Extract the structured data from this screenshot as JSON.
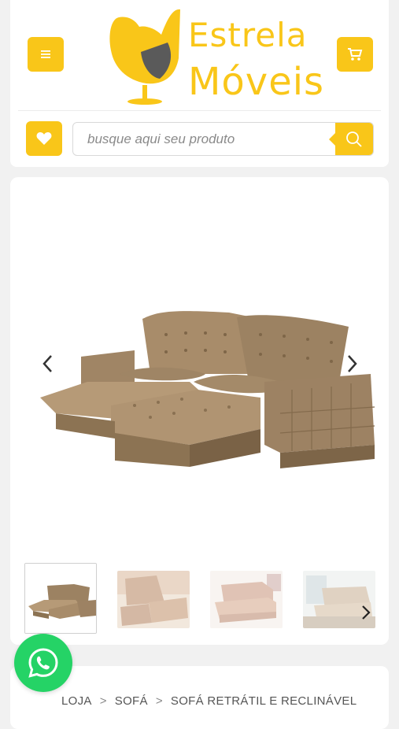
{
  "header": {
    "logo": {
      "line1": "Estrela",
      "line2": "Móveis"
    },
    "search": {
      "placeholder": "busque aqui seu produto",
      "value": ""
    },
    "icons": {
      "menu": "menu-icon",
      "cart": "cart-icon",
      "favorites": "heart-icon",
      "search": "search-icon"
    }
  },
  "product": {
    "main_image": "retractable-reclining-sofa",
    "thumbnails": [
      {
        "alt": "sofa-thumbnail-1",
        "active": true
      },
      {
        "alt": "sofa-thumbnail-2",
        "active": false
      },
      {
        "alt": "sofa-thumbnail-3",
        "active": false
      },
      {
        "alt": "sofa-thumbnail-4",
        "active": false
      }
    ]
  },
  "breadcrumb": {
    "items": [
      "LOJA",
      "SOFÁ",
      "SOFÁ RETRÁTIL E RECLINÁVEL"
    ],
    "separator": ">"
  },
  "colors": {
    "accent": "#f9c619",
    "whatsapp": "#25d366",
    "logo_gray": "#5a5a5a"
  }
}
